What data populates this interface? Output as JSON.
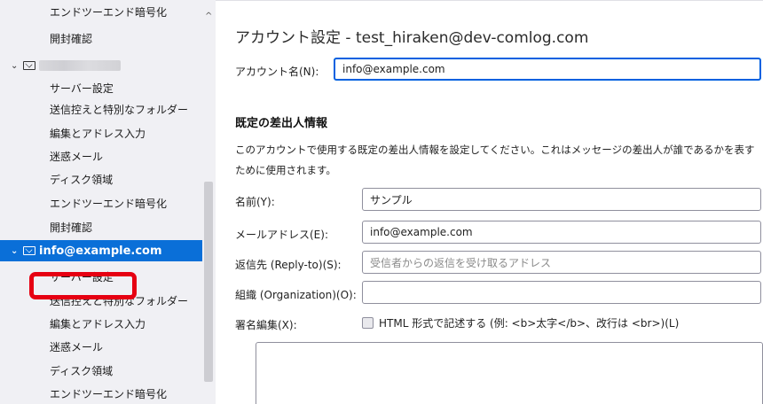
{
  "sidebar": {
    "rows": [
      {
        "label": "エンドツーエンド暗号化",
        "kind": "child"
      },
      {
        "label": "開封確認",
        "kind": "child"
      },
      {
        "label": "",
        "kind": "account-blurred"
      },
      {
        "label": "サーバー設定",
        "kind": "child"
      },
      {
        "label": "送信控えと特別なフォルダー",
        "kind": "child"
      },
      {
        "label": "編集とアドレス入力",
        "kind": "child"
      },
      {
        "label": "迷惑メール",
        "kind": "child"
      },
      {
        "label": "ディスク領域",
        "kind": "child"
      },
      {
        "label": "エンドツーエンド暗号化",
        "kind": "child"
      },
      {
        "label": "開封確認",
        "kind": "child"
      },
      {
        "label": "info@example.com",
        "kind": "account-selected"
      },
      {
        "label": "サーバー設定",
        "kind": "child-highlighted"
      },
      {
        "label": "送信控えと特別なフォルダー",
        "kind": "child"
      },
      {
        "label": "編集とアドレス入力",
        "kind": "child"
      },
      {
        "label": "迷惑メール",
        "kind": "child"
      },
      {
        "label": "ディスク領域",
        "kind": "child"
      },
      {
        "label": "エンドツーエンド暗号化",
        "kind": "child"
      }
    ],
    "highlight_color": "#e60012",
    "selected_color": "#0a6fd8"
  },
  "main": {
    "title": "アカウント設定 - test_hiraken@dev-comlog.com",
    "account_name_label": "アカウント名(N):",
    "account_name_value": "info@example.com",
    "section_title": "既定の差出人情報",
    "section_desc": "このアカウントで使用する既定の差出人情報を設定してください。これはメッセージの差出人が誰であるかを表すために使用されます。",
    "name_label": "名前(Y):",
    "name_value": "サンプル",
    "email_label": "メールアドレス(E):",
    "email_value": "info@example.com",
    "replyto_label": "返信先 (Reply-to)(S):",
    "replyto_placeholder": "受信者からの返信を受け取るアドレス",
    "org_label": "組織 (Organization)(O):",
    "org_value": "",
    "signature_label": "署名編集(X):",
    "signature_html_label": "HTML 形式で記述する (例: <b>太字</b>、改行は <br>)(L)"
  }
}
